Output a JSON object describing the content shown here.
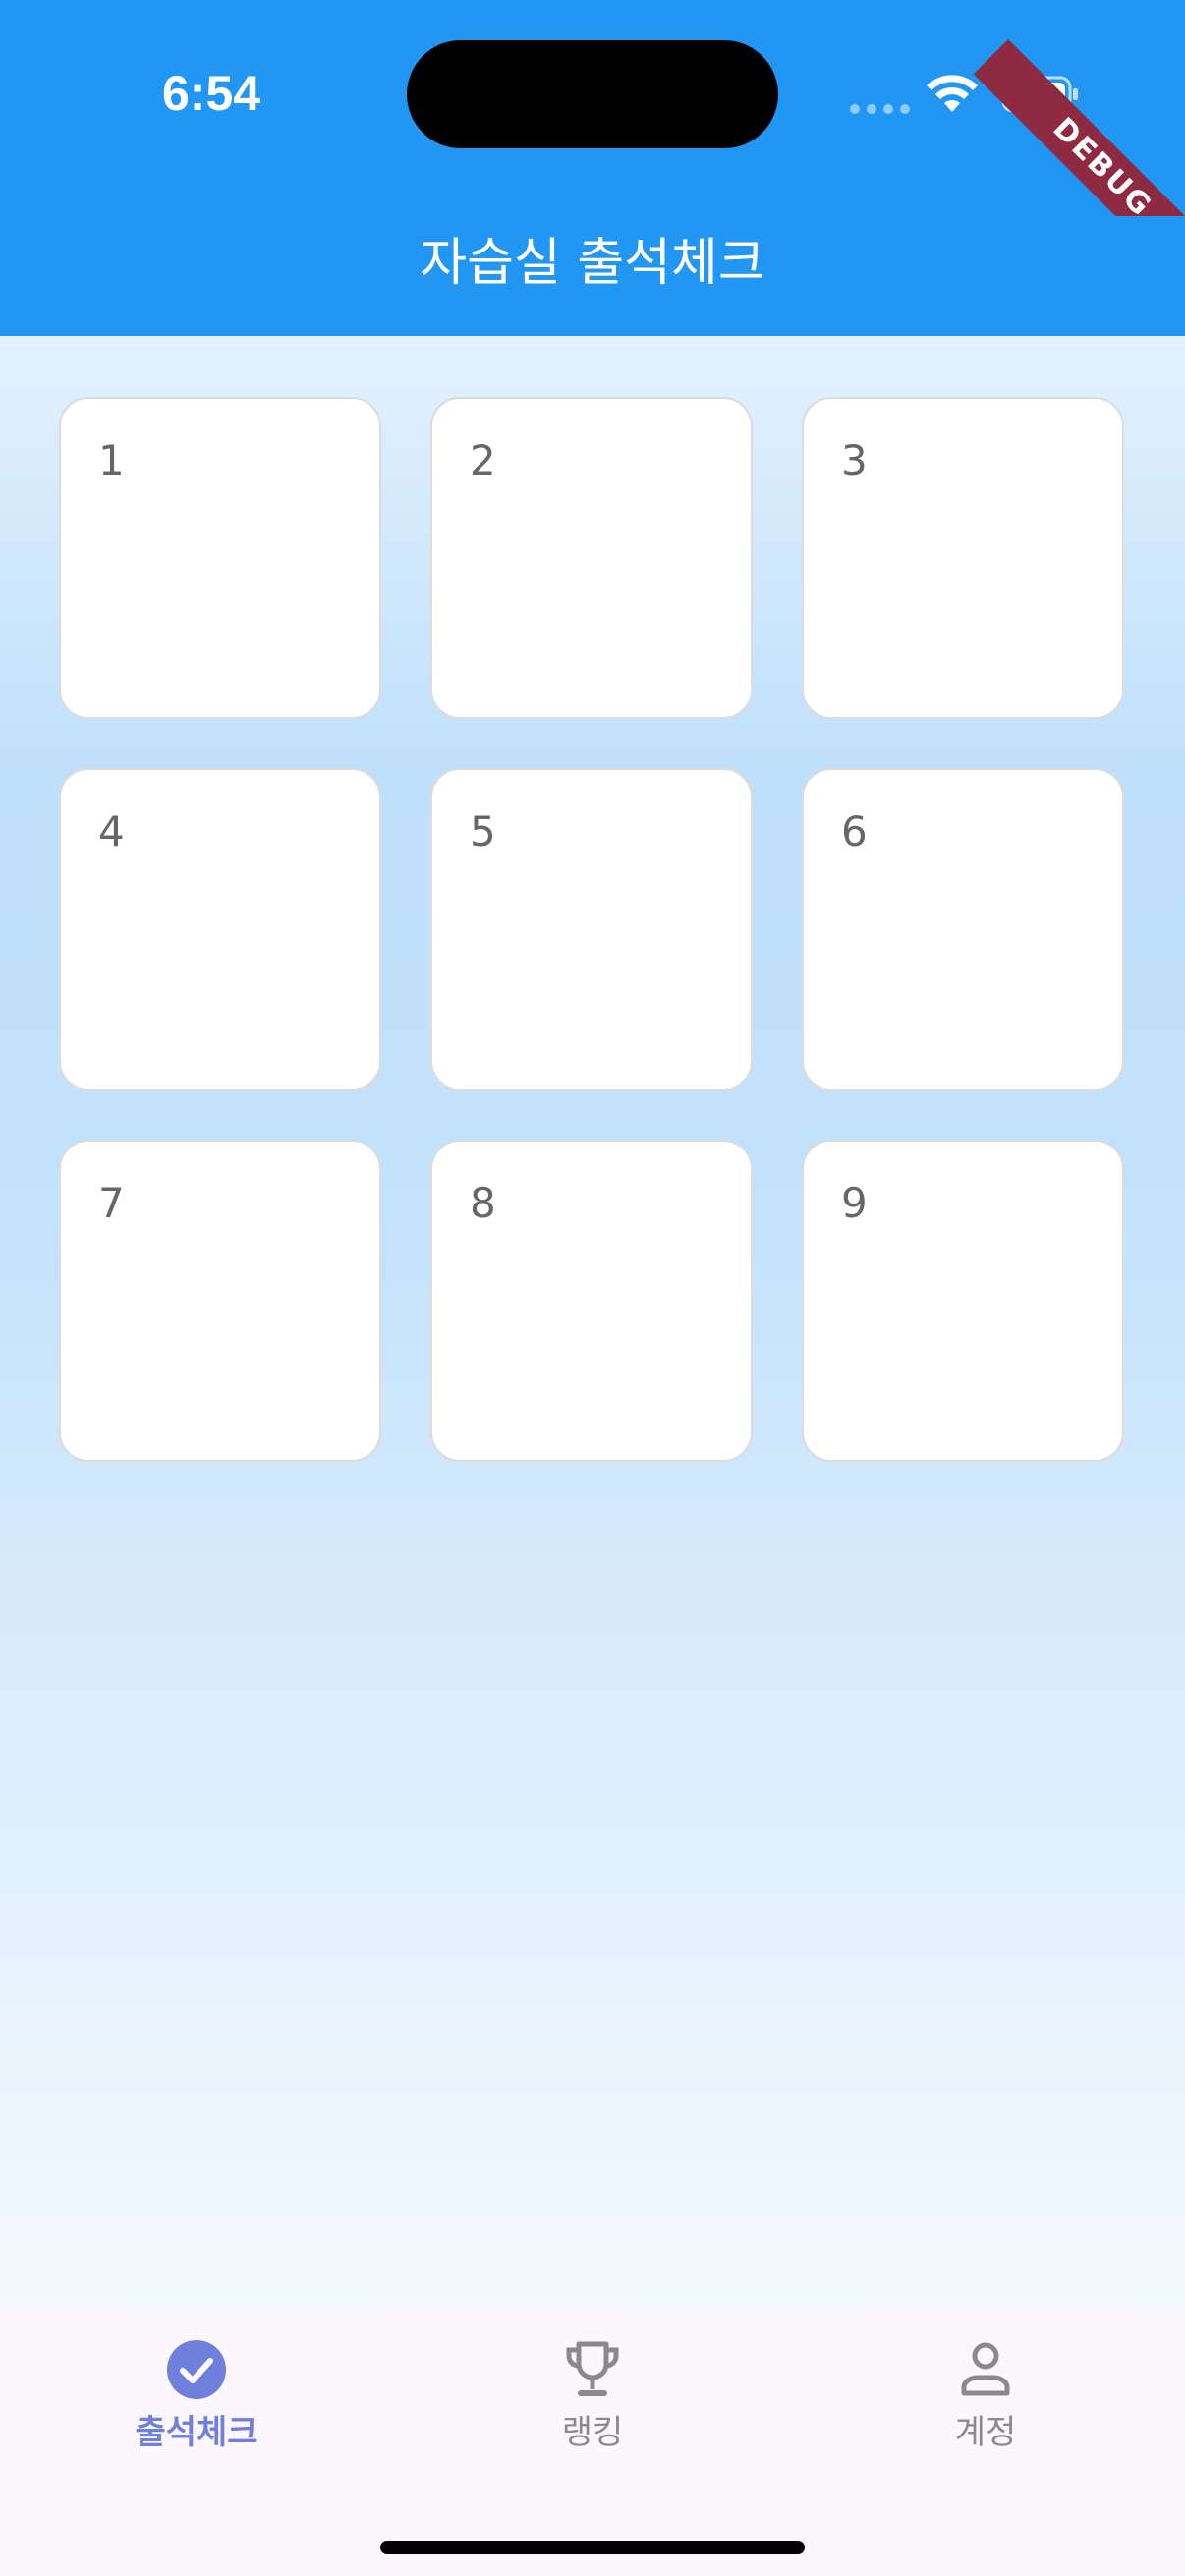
{
  "status_bar": {
    "time": "6:54"
  },
  "debug_banner": {
    "label": "DEBUG"
  },
  "app_bar": {
    "title": "자습실 출석체크"
  },
  "seats": [
    "1",
    "2",
    "3",
    "4",
    "5",
    "6",
    "7",
    "8",
    "9"
  ],
  "bottom_nav": {
    "items": [
      {
        "label": "출석체크",
        "icon": "check-circle-icon",
        "active": true
      },
      {
        "label": "랭킹",
        "icon": "trophy-icon",
        "active": false
      },
      {
        "label": "계정",
        "icon": "person-icon",
        "active": false
      }
    ]
  },
  "colors": {
    "app_bar": "#2196F3",
    "active_nav": "#6f7fdc",
    "inactive_nav": "#8a8a8a",
    "debug_banner": "#8e2b43"
  }
}
